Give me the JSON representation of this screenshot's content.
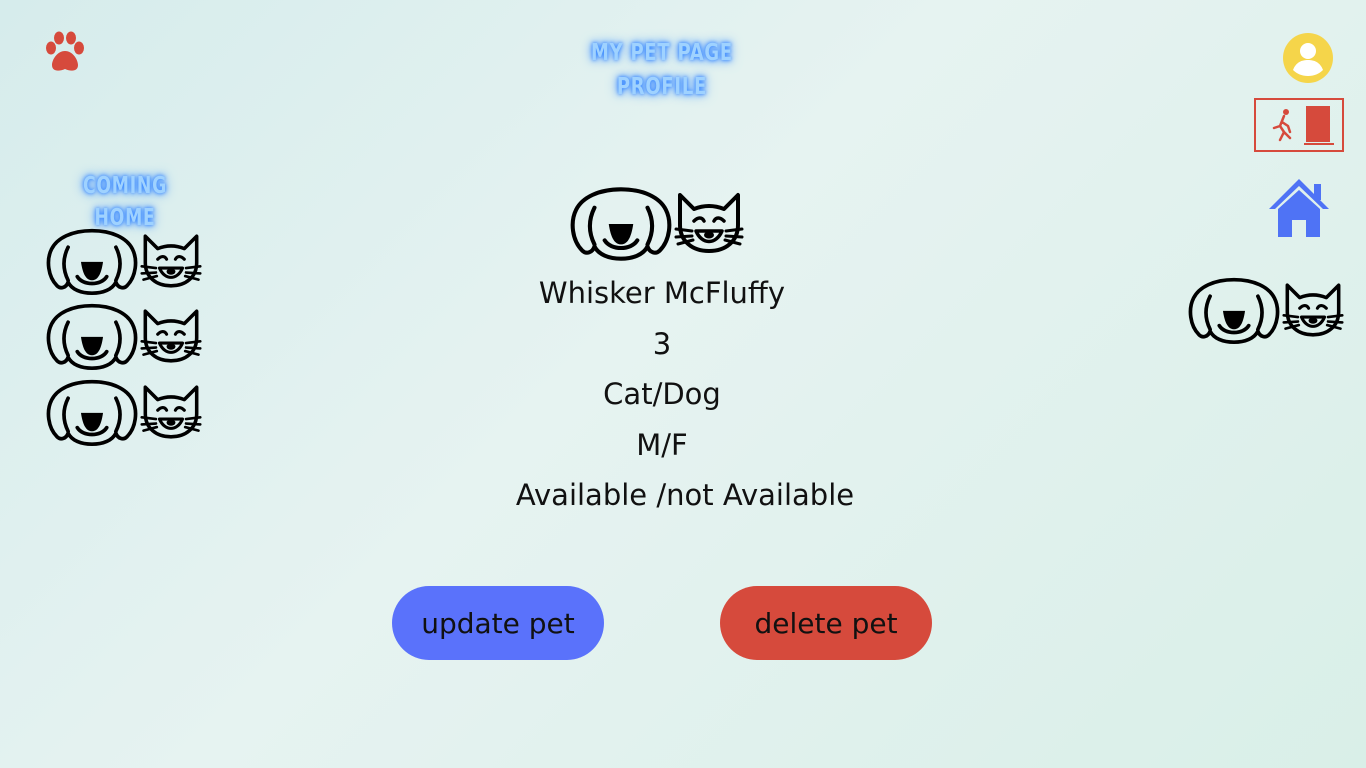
{
  "header": {
    "title_line1": "My Pet Page",
    "title_line2": "Profile"
  },
  "sidebar": {
    "heading": "Coming Home"
  },
  "pet": {
    "name": "Whisker McFluffy",
    "age": "3",
    "type": "Cat/Dog",
    "sex": "M/F",
    "availability": "Available /not Available"
  },
  "actions": {
    "update_label": "update pet",
    "delete_label": "delete pet"
  },
  "colors": {
    "paw": "#d64a3c",
    "profile_icon": "#f5d54a",
    "exit_icon": "#d64a3c",
    "home_icon": "#4f73f5",
    "update_button": "#5a72fb",
    "delete_button": "#d64a3c"
  },
  "icons": [
    "paw-icon",
    "profile-icon",
    "exit-icon",
    "home-icon",
    "dog-icon",
    "cat-icon"
  ]
}
